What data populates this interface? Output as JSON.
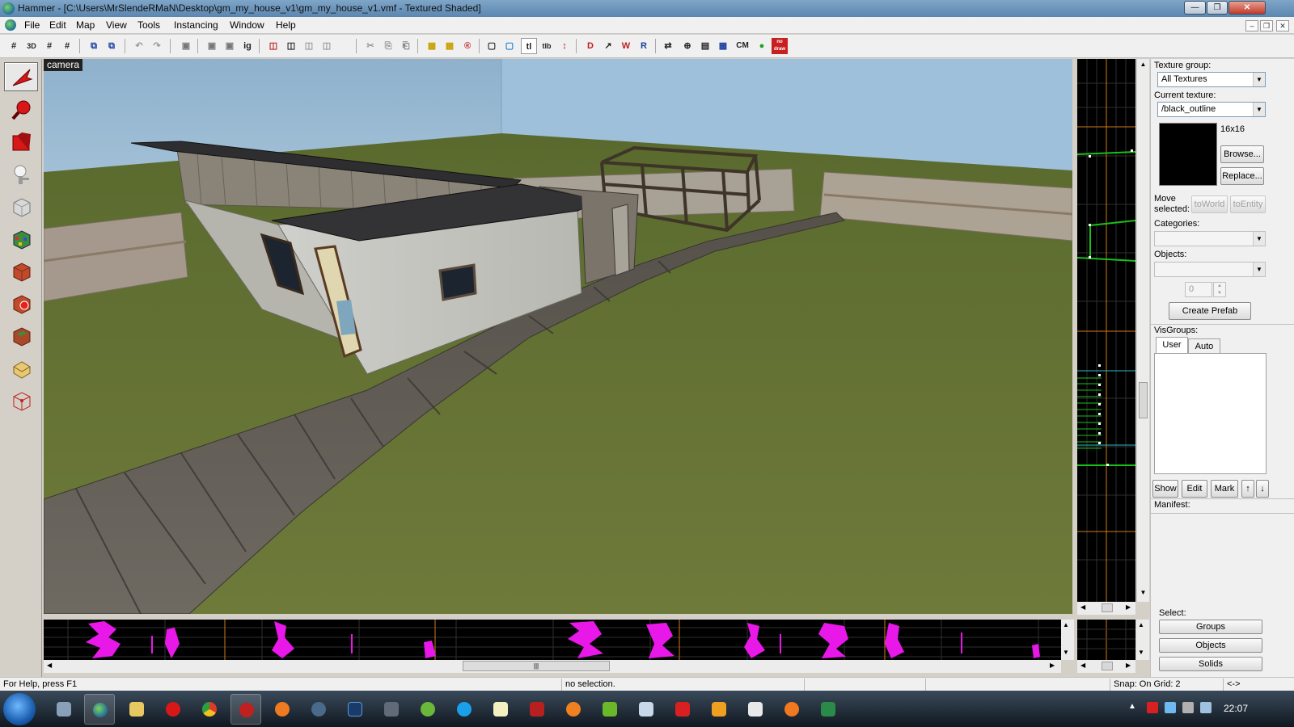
{
  "window": {
    "title": "Hammer - [C:\\Users\\MrSlendeRMaN\\Desktop\\gm_my_house_v1\\gm_my_house_v1.vmf - Textured Shaded]",
    "minimize": "—",
    "maximize": "❐",
    "close": "✕"
  },
  "menu": {
    "items": [
      "File",
      "Edit",
      "Map",
      "View",
      "Tools",
      "Instancing",
      "Window",
      "Help"
    ],
    "mdi_minimize": "–",
    "mdi_restore": "❐",
    "mdi_close": "✕"
  },
  "toolbar": {
    "buttons": [
      "#",
      "3D",
      "#",
      "#",
      "⧉",
      "⧉",
      "↶",
      "↷",
      "▣",
      "▣",
      "▣",
      "ig",
      "◫",
      "◫",
      "◫",
      "◫",
      "✂",
      "⎘",
      "⎗",
      "▦",
      "▦",
      "®",
      "▢",
      "▢",
      "tl",
      "tlb",
      "↕",
      "D",
      "↗",
      "W",
      "R",
      "⇄",
      "⊕",
      "▤",
      "▦",
      "CM",
      "●",
      "no draw"
    ]
  },
  "tools": [
    "Selection Tool",
    "Magnify",
    "Camera",
    "Entity Tool",
    "Block Tool",
    "Toggle Texture Application",
    "Apply Current Texture",
    "Apply Decals",
    "Apply Overlays",
    "Clipping Tool",
    "Vertex Tool"
  ],
  "viewport3d": {
    "label": "camera"
  },
  "right_panel": {
    "texture_group_label": "Texture group:",
    "texture_group_value": "All Textures",
    "current_texture_label": "Current texture:",
    "current_texture_value": "/black_outline",
    "texture_size": "16x16",
    "browse_button": "Browse...",
    "replace_button": "Replace...",
    "move_selected_label": "Move selected:",
    "to_world_button": "toWorld",
    "to_entity_button": "toEntity",
    "categories_label": "Categories:",
    "objects_label": "Objects:",
    "objects_spin_value": "0",
    "create_prefab_button": "Create Prefab",
    "visgroups_label": "VisGroups:",
    "visgroups_tabs": [
      "User",
      "Auto"
    ],
    "show_button": "Show",
    "edit_button": "Edit",
    "mark_button": "Mark",
    "up_arrow": "↑",
    "down_arrow": "↓",
    "manifest_label": "Manifest:",
    "select_label": "Select:",
    "groups_button": "Groups",
    "objects_button": "Objects",
    "solids_button": "Solids"
  },
  "statusbar": {
    "help": "For Help, press F1",
    "selection": "no selection.",
    "snap": "Snap: On Grid: 2",
    "extra": "<->"
  },
  "taskbar": {
    "time": "22:07",
    "apps": [
      "desktop",
      "hammer",
      "explorer",
      "opera",
      "chrome",
      "media",
      "origin",
      "steam",
      "photoshop",
      "app",
      "utorrent",
      "skype",
      "notepad",
      "game",
      "ea",
      "nvidia",
      "command",
      "acrobat",
      "kh",
      "cube",
      "avast",
      "aegisub"
    ]
  },
  "colors": {
    "accent": "#3a6ea5",
    "grid_green": "#18c018",
    "grid_orange": "#d07a1a",
    "magenta": "#e818e8"
  }
}
